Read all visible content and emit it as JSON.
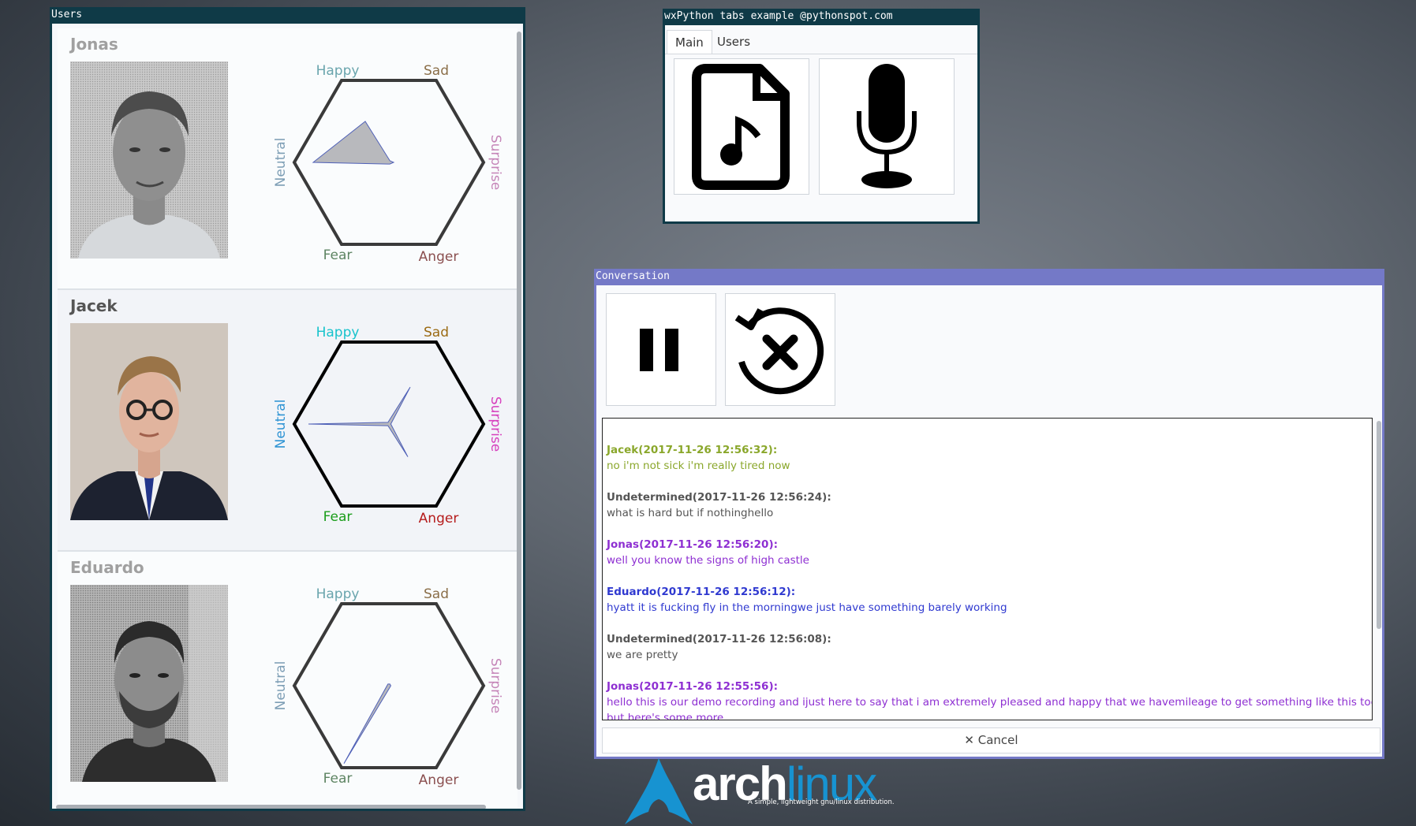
{
  "users_window": {
    "title": "Users",
    "users": [
      {
        "name": "Jonas",
        "state": "inactive",
        "labels": {
          "happy": "Happy",
          "sad": "Sad",
          "surprise": "Surprise",
          "anger": "Anger",
          "fear": "Fear",
          "neutral": "Neutral"
        },
        "emotions": {
          "happy": 0.5,
          "sad": 0.0,
          "surprise": 0.05,
          "anger": 0.0,
          "fear": 0.0,
          "neutral": 0.8
        }
      },
      {
        "name": "Jacek",
        "state": "active",
        "labels": {
          "happy": "Happy",
          "sad": "Sad",
          "surprise": "Surprise",
          "anger": "Anger",
          "fear": "Fear",
          "neutral": "Neutral"
        },
        "emotions": {
          "happy": 0.0,
          "sad": 0.45,
          "surprise": 0.0,
          "anger": 0.4,
          "fear": 0.0,
          "neutral": 0.85
        }
      },
      {
        "name": "Eduardo",
        "state": "inactive",
        "labels": {
          "happy": "Happy",
          "sad": "Sad",
          "surprise": "Surprise",
          "anger": "Anger",
          "fear": "Fear",
          "neutral": "Neutral"
        },
        "emotions": {
          "happy": 0.0,
          "sad": 0.0,
          "surprise": 0.0,
          "anger": 0.0,
          "fear": 0.95,
          "neutral": 0.0
        }
      }
    ]
  },
  "tabs_window": {
    "title": "wxPython tabs example @pythonspot.com",
    "tabs": [
      "Main",
      "Users"
    ],
    "selected_tab": "Main",
    "buttons": [
      {
        "icon": "audio-file-icon"
      },
      {
        "icon": "microphone-icon"
      }
    ]
  },
  "conversation_window": {
    "title": "Conversation",
    "buttons": [
      {
        "icon": "pause-icon"
      },
      {
        "icon": "cancel-restart-icon"
      }
    ],
    "messages": [
      {
        "speaker": "Jacek",
        "timestamp": "(2017-11-26 12:56:32):",
        "text": "no i'm not sick i'm really tired now",
        "color": "#8aa72b"
      },
      {
        "speaker": "Undetermined",
        "timestamp": "(2017-11-26 12:56:24):",
        "text": "what is hard but if nothinghello",
        "color": "#555555"
      },
      {
        "speaker": "Jonas",
        "timestamp": "(2017-11-26 12:56:20):",
        "text": "well you know the signs of high castle",
        "color": "#8e2fd2"
      },
      {
        "speaker": "Eduardo",
        "timestamp": "(2017-11-26 12:56:12):",
        "text": "hyatt it is fucking fly in the morningwe just have something barely working",
        "color": "#2f39d0"
      },
      {
        "speaker": "Undetermined",
        "timestamp": "(2017-11-26 12:56:08):",
        "text": "we are pretty",
        "color": "#555555"
      },
      {
        "speaker": "Jonas",
        "timestamp": "(2017-11-26 12:55:56):",
        "text": "hello this is our demo recording and ijust here to say that i am extremely pleased and happy that we havemileage to get something like this together",
        "color": "#8e2fd2"
      },
      {
        "speaker": "",
        "timestamp": "",
        "text": "but here's some more",
        "color": "#8e2fd2"
      }
    ],
    "cancel_label": "✕ Cancel"
  },
  "desktop": {
    "logo_word_1": "arch",
    "logo_word_2": "linux",
    "logo_tagline": "A simple, lightweight gnu/linux distribution."
  },
  "colors": {
    "users_titlebar": "#0f3a47",
    "conversation_titlebar": "#7479c7",
    "arch_blue": "#1793d1",
    "active_labels": {
      "happy": "#18c3cc",
      "sad": "#9b6a12",
      "surprise": "#d63fbd",
      "anger": "#b51b1b",
      "fear": "#1a9d1a",
      "neutral": "#2f94d4"
    },
    "inactive_labels": {
      "happy": "#6aa5ad",
      "sad": "#8a6e48",
      "surprise": "#c585b8",
      "anger": "#8a4f4f",
      "fear": "#5d8462",
      "neutral": "#7d9eb5"
    }
  }
}
